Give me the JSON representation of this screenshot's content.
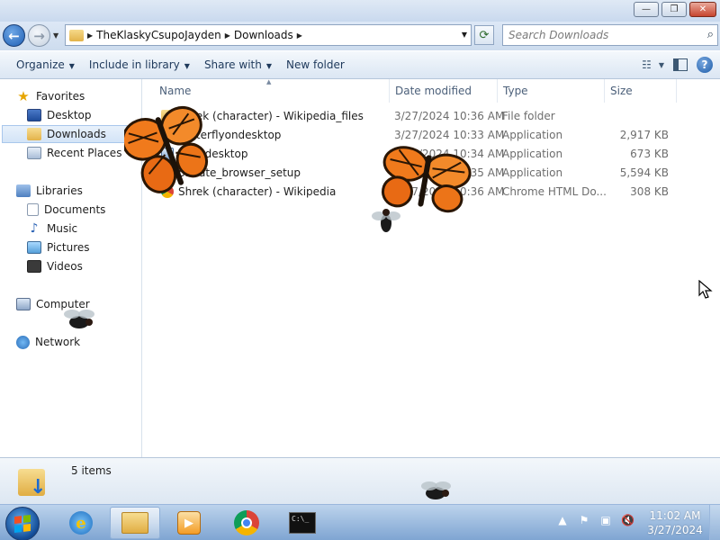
{
  "window": {
    "controls": {
      "minimize": "—",
      "maximize": "❐",
      "close": "✕"
    }
  },
  "address": {
    "breadcrumbs": [
      "TheKlaskyCsupoJayden",
      "Downloads"
    ],
    "search_placeholder": "Search Downloads"
  },
  "toolbar": {
    "organize": "Organize",
    "include_in_library": "Include in library",
    "share_with": "Share with",
    "new_folder": "New folder"
  },
  "nav": {
    "favorites": "Favorites",
    "desktop": "Desktop",
    "downloads": "Downloads",
    "recent_places": "Recent Places",
    "libraries": "Libraries",
    "documents": "Documents",
    "music": "Music",
    "pictures": "Pictures",
    "videos": "Videos",
    "computer": "Computer",
    "network": "Network"
  },
  "columns": {
    "name": "Name",
    "date": "Date modified",
    "type": "Type",
    "size": "Size"
  },
  "files": [
    {
      "name": "Shrek (character) - Wikipedia_files",
      "date": "3/27/2024 10:36 AM",
      "type": "File folder",
      "size": "",
      "icon": "folder"
    },
    {
      "name": "butterflyondesktop",
      "date": "3/27/2024 10:33 AM",
      "type": "Application",
      "size": "2,917 KB",
      "icon": "app"
    },
    {
      "name": "flyondesktop",
      "date": "3/27/2024 10:34 AM",
      "type": "Application",
      "size": "673 KB",
      "icon": "app"
    },
    {
      "name": "private_browser_setup",
      "date": "3/27/2024 10:35 AM",
      "type": "Application",
      "size": "5,594 KB",
      "icon": "app"
    },
    {
      "name": "Shrek (character) - Wikipedia",
      "date": "3/27/2024 10:36 AM",
      "type": "Chrome HTML Do...",
      "size": "308 KB",
      "icon": "chrome"
    }
  ],
  "details": {
    "item_count": "5 items"
  },
  "taskbar": {
    "apps": [
      "internet-explorer",
      "windows-explorer",
      "media-player",
      "google-chrome",
      "command-prompt"
    ],
    "cmd_glyph": "C:\\_",
    "time": "11:02 AM",
    "date": "3/27/2024"
  },
  "colors": {
    "accent": "#1f5fb4",
    "taskbar": "#9dbde3",
    "butterfly": "#f0741c"
  }
}
